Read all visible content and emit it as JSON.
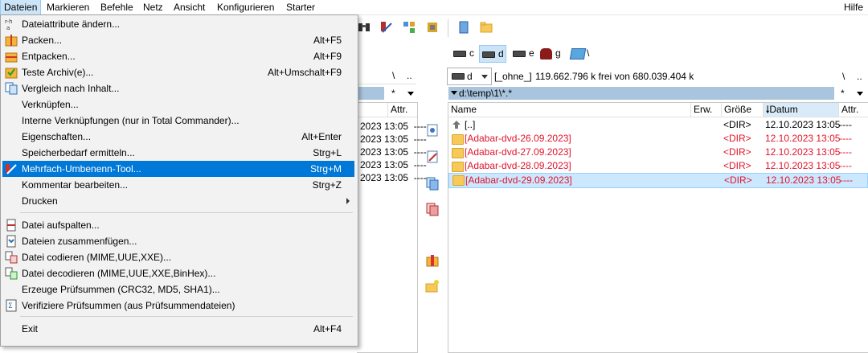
{
  "menubar": {
    "items": [
      "Dateien",
      "Markieren",
      "Befehle",
      "Netz",
      "Ansicht",
      "Konfigurieren",
      "Starter"
    ],
    "help": "Hilfe"
  },
  "menu": {
    "items": [
      {
        "label": "Dateiattribute ändern...",
        "shortcut": "",
        "icon": "attributes-icon"
      },
      {
        "label": "Packen...",
        "shortcut": "Alt+F5",
        "icon": "pack-icon"
      },
      {
        "label": "Entpacken...",
        "shortcut": "Alt+F9",
        "icon": "unpack-icon"
      },
      {
        "label": "Teste Archiv(e)...",
        "shortcut": "Alt+Umschalt+F9",
        "icon": "test-archive-icon"
      },
      {
        "label": "Vergleich nach Inhalt...",
        "shortcut": "",
        "icon": "compare-icon"
      },
      {
        "label": "Verknüpfen...",
        "shortcut": "",
        "icon": ""
      },
      {
        "label": "Interne Verknüpfungen (nur in Total Commander)...",
        "shortcut": "",
        "icon": ""
      },
      {
        "label": "Eigenschaften...",
        "shortcut": "Alt+Enter",
        "icon": ""
      },
      {
        "label": "Speicherbedarf ermitteln...",
        "shortcut": "Strg+L",
        "icon": ""
      },
      {
        "label": "Mehrfach-Umbenenn-Tool...",
        "shortcut": "Strg+M",
        "icon": "multi-rename-icon"
      },
      {
        "label": "Kommentar bearbeiten...",
        "shortcut": "Strg+Z",
        "icon": ""
      },
      {
        "label": "Drucken",
        "shortcut": "",
        "icon": ""
      },
      {
        "label": "Datei aufspalten...",
        "shortcut": "",
        "icon": "split-icon"
      },
      {
        "label": "Dateien zusammenfügen...",
        "shortcut": "",
        "icon": "combine-icon"
      },
      {
        "label": "Datei codieren (MIME,UUE,XXE)...",
        "shortcut": "",
        "icon": "encode-icon"
      },
      {
        "label": "Datei decodieren (MIME,UUE,XXE,BinHex)...",
        "shortcut": "",
        "icon": "decode-icon"
      },
      {
        "label": "Erzeuge Prüfsummen (CRC32, MD5, SHA1)...",
        "shortcut": "",
        "icon": ""
      },
      {
        "label": "Verifiziere Prüfsummen (aus Prüfsummendateien)",
        "shortcut": "",
        "icon": "verify-checksum-icon"
      },
      {
        "label": "Exit",
        "shortcut": "Alt+F4",
        "icon": ""
      }
    ]
  },
  "drives": [
    "c",
    "d",
    "e",
    "g",
    "\\"
  ],
  "left_panel": {
    "path_controls": [
      "\\",
      ".."
    ],
    "filter": "*",
    "attr_header": "Attr.",
    "rows": [
      {
        "date": "2023 13:05",
        "attr": "----"
      },
      {
        "date": "2023 13:05",
        "attr": "----"
      },
      {
        "date": "2023 13:05",
        "attr": "----"
      },
      {
        "date": "2023 13:05",
        "attr": "----"
      },
      {
        "date": "2023 13:05",
        "attr": "----"
      }
    ]
  },
  "right_panel": {
    "drive_select": "d",
    "volume_label": "[_ohne_]",
    "free_space": "119.662.796 k frei von 680.039.404 k",
    "path_controls": [
      "\\",
      ".."
    ],
    "path": "d:\\temp\\1\\*.*",
    "filter": "*",
    "columns": {
      "name": "Name",
      "ext": "Erw.",
      "size": "Größe",
      "date": "Datum",
      "attr": "Attr."
    },
    "rows": [
      {
        "name": "[..]",
        "size": "<DIR>",
        "date": "12.10.2023 13:05",
        "attr": "----",
        "red": false
      },
      {
        "name": "[Adabar-dvd-26.09.2023]",
        "size": "<DIR>",
        "date": "12.10.2023 13:05",
        "attr": "----",
        "red": true
      },
      {
        "name": "[Adabar-dvd-27.09.2023]",
        "size": "<DIR>",
        "date": "12.10.2023 13:05",
        "attr": "----",
        "red": true
      },
      {
        "name": "[Adabar-dvd-28.09.2023]",
        "size": "<DIR>",
        "date": "12.10.2023 13:05",
        "attr": "----",
        "red": true
      },
      {
        "name": "[Adabar-dvd-29.09.2023]",
        "size": "<DIR>",
        "date": "12.10.2023 13:05",
        "attr": "----",
        "red": true
      }
    ]
  }
}
